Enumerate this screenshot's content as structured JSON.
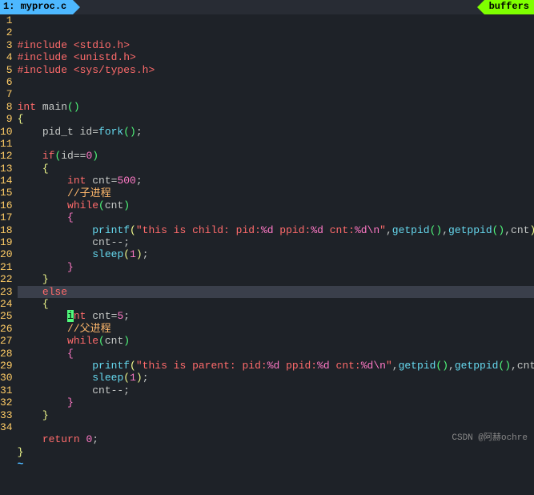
{
  "tab": {
    "index": "1",
    "filename": "myproc.c",
    "right_label": "buffers"
  },
  "cursor_line": 23,
  "watermark": "CSDN @阿赫ochre",
  "code_lines": [
    {
      "n": 1,
      "tokens": [
        {
          "t": "#include ",
          "c": "kw"
        },
        {
          "t": "<stdio.h>",
          "c": "str"
        }
      ]
    },
    {
      "n": 2,
      "tokens": [
        {
          "t": "#include ",
          "c": "kw"
        },
        {
          "t": "<unistd.h>",
          "c": "str"
        }
      ]
    },
    {
      "n": 3,
      "tokens": [
        {
          "t": "#include ",
          "c": "kw"
        },
        {
          "t": "<sys/types.h>",
          "c": "str"
        }
      ]
    },
    {
      "n": 4,
      "tokens": []
    },
    {
      "n": 5,
      "tokens": []
    },
    {
      "n": 6,
      "tokens": [
        {
          "t": "int",
          "c": "kw"
        },
        {
          "t": " main",
          "c": ""
        },
        {
          "t": "()",
          "c": "paren"
        }
      ]
    },
    {
      "n": 7,
      "tokens": [
        {
          "t": "{",
          "c": "brace"
        }
      ]
    },
    {
      "n": 8,
      "tokens": [
        {
          "t": "    pid_t id=",
          "c": ""
        },
        {
          "t": "fork",
          "c": "func"
        },
        {
          "t": "()",
          "c": "paren"
        },
        {
          "t": ";",
          "c": ""
        }
      ]
    },
    {
      "n": 9,
      "tokens": []
    },
    {
      "n": 10,
      "tokens": [
        {
          "t": "    ",
          "c": ""
        },
        {
          "t": "if",
          "c": "kw"
        },
        {
          "t": "(",
          "c": "paren"
        },
        {
          "t": "id==",
          "c": ""
        },
        {
          "t": "0",
          "c": "num"
        },
        {
          "t": ")",
          "c": "paren"
        }
      ]
    },
    {
      "n": 11,
      "tokens": [
        {
          "t": "    ",
          "c": ""
        },
        {
          "t": "{",
          "c": "brace"
        }
      ]
    },
    {
      "n": 12,
      "tokens": [
        {
          "t": "        ",
          "c": ""
        },
        {
          "t": "int",
          "c": "kw"
        },
        {
          "t": " cnt=",
          "c": ""
        },
        {
          "t": "500",
          "c": "num"
        },
        {
          "t": ";",
          "c": ""
        }
      ]
    },
    {
      "n": 13,
      "tokens": [
        {
          "t": "        ",
          "c": ""
        },
        {
          "t": "//子进程",
          "c": "comment"
        }
      ]
    },
    {
      "n": 14,
      "tokens": [
        {
          "t": "        ",
          "c": ""
        },
        {
          "t": "while",
          "c": "kw"
        },
        {
          "t": "(",
          "c": "paren"
        },
        {
          "t": "cnt",
          "c": ""
        },
        {
          "t": ")",
          "c": "paren"
        }
      ]
    },
    {
      "n": 15,
      "tokens": [
        {
          "t": "        ",
          "c": ""
        },
        {
          "t": "{",
          "c": "brace2"
        }
      ]
    },
    {
      "n": 16,
      "tokens": [
        {
          "t": "            ",
          "c": ""
        },
        {
          "t": "printf",
          "c": "func"
        },
        {
          "t": "(",
          "c": "brace"
        },
        {
          "t": "\"this is child: pid:",
          "c": "str"
        },
        {
          "t": "%d",
          "c": "fmt"
        },
        {
          "t": " ppid:",
          "c": "str"
        },
        {
          "t": "%d",
          "c": "fmt"
        },
        {
          "t": " cnt:",
          "c": "str"
        },
        {
          "t": "%d\\n",
          "c": "fmt"
        },
        {
          "t": "\"",
          "c": "str"
        },
        {
          "t": ",",
          "c": ""
        },
        {
          "t": "getpid",
          "c": "func"
        },
        {
          "t": "()",
          "c": "paren"
        },
        {
          "t": ",",
          "c": ""
        },
        {
          "t": "getppid",
          "c": "func"
        },
        {
          "t": "()",
          "c": "paren"
        },
        {
          "t": ",cnt",
          "c": ""
        },
        {
          "t": ")",
          "c": "brace"
        },
        {
          "t": ";",
          "c": ""
        }
      ]
    },
    {
      "n": 17,
      "tokens": [
        {
          "t": "            cnt--;",
          "c": ""
        }
      ]
    },
    {
      "n": 18,
      "tokens": [
        {
          "t": "            ",
          "c": ""
        },
        {
          "t": "sleep",
          "c": "func"
        },
        {
          "t": "(",
          "c": "brace"
        },
        {
          "t": "1",
          "c": "num"
        },
        {
          "t": ")",
          "c": "brace"
        },
        {
          "t": ";",
          "c": ""
        }
      ]
    },
    {
      "n": 19,
      "tokens": [
        {
          "t": "        ",
          "c": ""
        },
        {
          "t": "}",
          "c": "brace2"
        }
      ]
    },
    {
      "n": 20,
      "tokens": [
        {
          "t": "    ",
          "c": ""
        },
        {
          "t": "}",
          "c": "brace"
        }
      ]
    },
    {
      "n": 21,
      "tokens": [
        {
          "t": "    ",
          "c": ""
        },
        {
          "t": "else",
          "c": "kw"
        }
      ]
    },
    {
      "n": 22,
      "tokens": [
        {
          "t": "    ",
          "c": ""
        },
        {
          "t": "{",
          "c": "brace"
        }
      ]
    },
    {
      "n": 23,
      "tokens": [
        {
          "t": "        ",
          "c": ""
        },
        {
          "t": "i",
          "c": "cursor"
        },
        {
          "t": "nt",
          "c": "kw"
        },
        {
          "t": " cnt=",
          "c": ""
        },
        {
          "t": "5",
          "c": "num"
        },
        {
          "t": ";",
          "c": ""
        }
      ]
    },
    {
      "n": 24,
      "tokens": [
        {
          "t": "        ",
          "c": ""
        },
        {
          "t": "//父进程",
          "c": "comment"
        }
      ]
    },
    {
      "n": 25,
      "tokens": [
        {
          "t": "        ",
          "c": ""
        },
        {
          "t": "while",
          "c": "kw"
        },
        {
          "t": "(",
          "c": "paren"
        },
        {
          "t": "cnt",
          "c": ""
        },
        {
          "t": ")",
          "c": "paren"
        }
      ]
    },
    {
      "n": 26,
      "tokens": [
        {
          "t": "        ",
          "c": ""
        },
        {
          "t": "{",
          "c": "brace2"
        }
      ]
    },
    {
      "n": 27,
      "tokens": [
        {
          "t": "            ",
          "c": ""
        },
        {
          "t": "printf",
          "c": "func"
        },
        {
          "t": "(",
          "c": "brace"
        },
        {
          "t": "\"this is parent: pid:",
          "c": "str"
        },
        {
          "t": "%d",
          "c": "fmt"
        },
        {
          "t": " ppid:",
          "c": "str"
        },
        {
          "t": "%d",
          "c": "fmt"
        },
        {
          "t": " cnt:",
          "c": "str"
        },
        {
          "t": "%d\\n",
          "c": "fmt"
        },
        {
          "t": "\"",
          "c": "str"
        },
        {
          "t": ",",
          "c": ""
        },
        {
          "t": "getpid",
          "c": "func"
        },
        {
          "t": "()",
          "c": "paren"
        },
        {
          "t": ",",
          "c": ""
        },
        {
          "t": "getppid",
          "c": "func"
        },
        {
          "t": "()",
          "c": "paren"
        },
        {
          "t": ",cnt",
          "c": ""
        },
        {
          "t": ")",
          "c": "brace"
        },
        {
          "t": ";",
          "c": ""
        }
      ]
    },
    {
      "n": 28,
      "tokens": [
        {
          "t": "            ",
          "c": ""
        },
        {
          "t": "sleep",
          "c": "func"
        },
        {
          "t": "(",
          "c": "brace"
        },
        {
          "t": "1",
          "c": "num"
        },
        {
          "t": ")",
          "c": "brace"
        },
        {
          "t": ";",
          "c": ""
        }
      ]
    },
    {
      "n": 29,
      "tokens": [
        {
          "t": "            cnt--;",
          "c": ""
        }
      ]
    },
    {
      "n": 30,
      "tokens": [
        {
          "t": "        ",
          "c": ""
        },
        {
          "t": "}",
          "c": "brace2"
        }
      ]
    },
    {
      "n": 31,
      "tokens": [
        {
          "t": "    ",
          "c": ""
        },
        {
          "t": "}",
          "c": "brace"
        }
      ]
    },
    {
      "n": 32,
      "tokens": []
    },
    {
      "n": 33,
      "tokens": [
        {
          "t": "    ",
          "c": ""
        },
        {
          "t": "return",
          "c": "kw"
        },
        {
          "t": " ",
          "c": ""
        },
        {
          "t": "0",
          "c": "num"
        },
        {
          "t": ";",
          "c": ""
        }
      ]
    },
    {
      "n": 34,
      "tokens": [
        {
          "t": "}",
          "c": "brace"
        }
      ]
    }
  ]
}
